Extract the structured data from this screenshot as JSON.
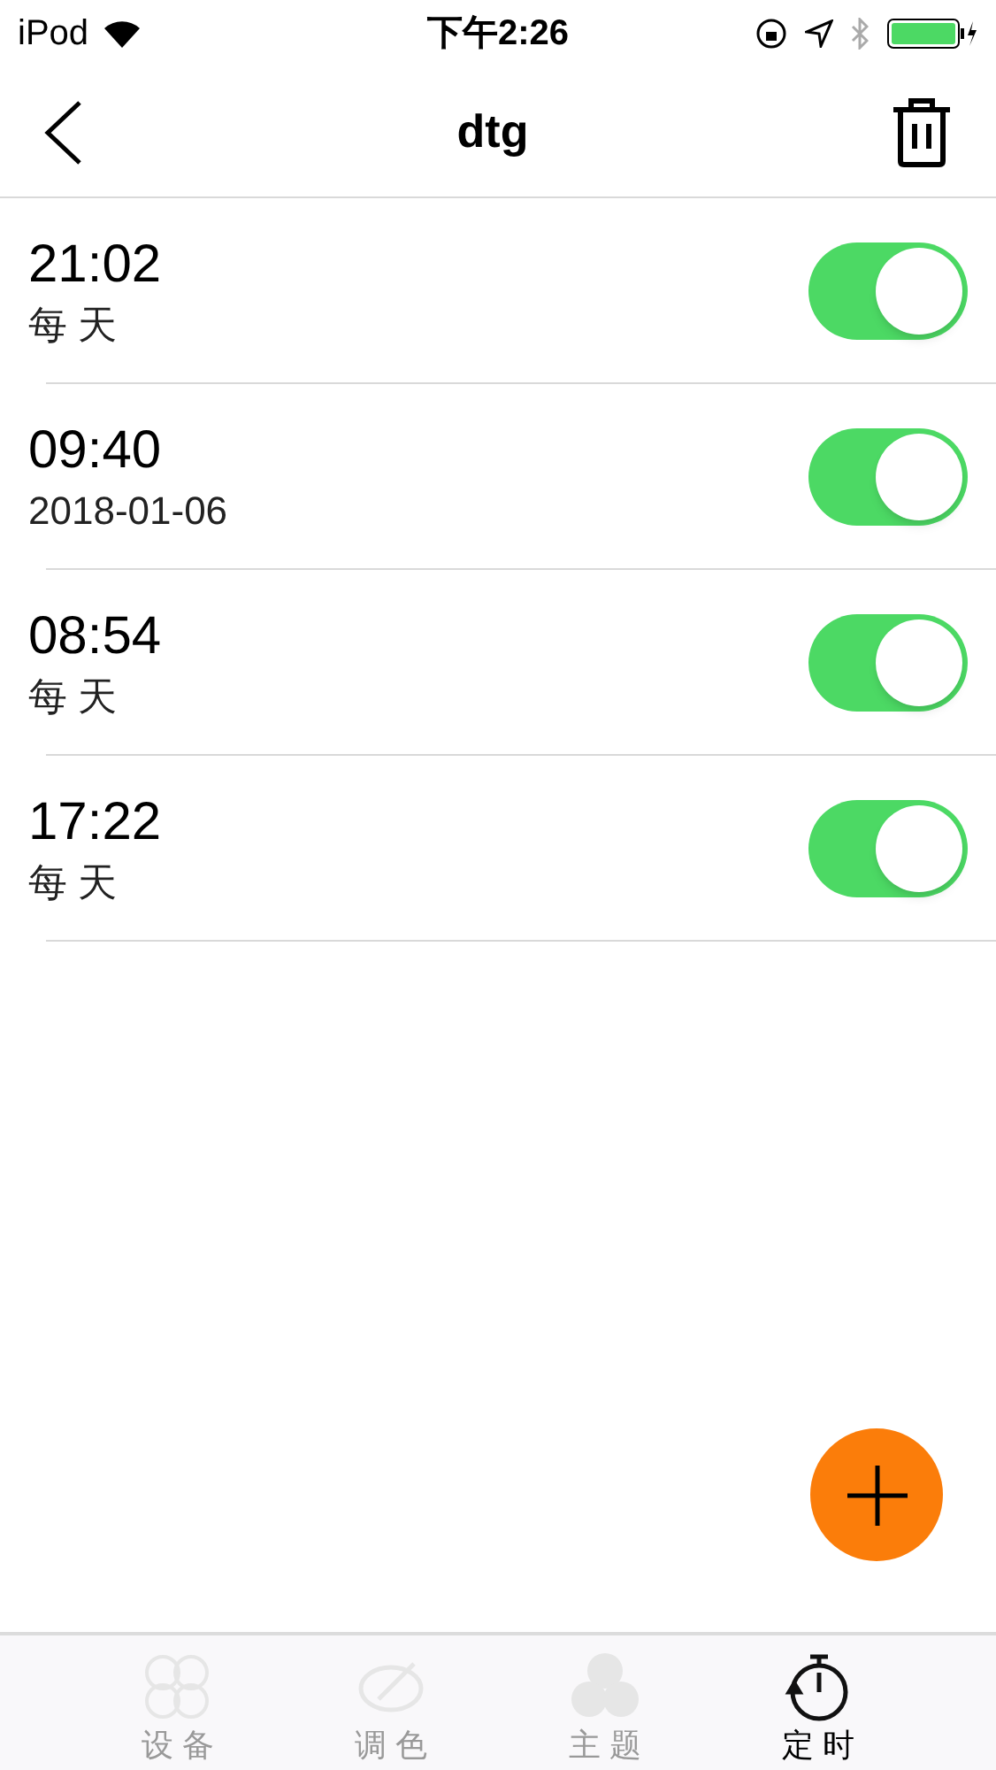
{
  "status_bar": {
    "carrier": "iPod",
    "time": "下午2:26"
  },
  "nav": {
    "title": "dtg"
  },
  "timers": [
    {
      "time": "21:02",
      "repeat": "每 天",
      "on": true
    },
    {
      "time": "09:40",
      "repeat": "2018-01-06",
      "on": true
    },
    {
      "time": "08:54",
      "repeat": "每 天",
      "on": true
    },
    {
      "time": "17:22",
      "repeat": "每 天",
      "on": true
    }
  ],
  "tabs": [
    {
      "label": "设 备",
      "selected": false
    },
    {
      "label": "调 色",
      "selected": false
    },
    {
      "label": "主 题",
      "selected": false
    },
    {
      "label": "定 时",
      "selected": true
    }
  ]
}
